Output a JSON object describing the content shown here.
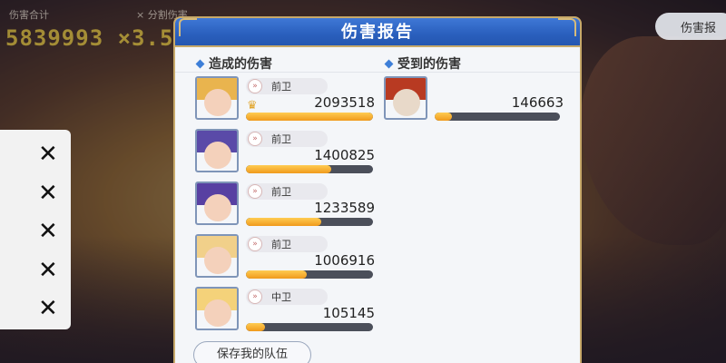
{
  "hud": {
    "total_label": "伤害合计",
    "dps_label": "× 分割伤害",
    "total_value": "5839993 ×3.5"
  },
  "top_right": {
    "label": "伤害报"
  },
  "side_panel": {
    "items": [
      "✕",
      "✕",
      "✕",
      "✕",
      "✕"
    ]
  },
  "dialog": {
    "title": "伤害报告",
    "dealt_title": "造成的伤害",
    "received_title": "受到的伤害",
    "save_label": "保存我的队伍"
  },
  "dealt": [
    {
      "role": "前卫",
      "value": "2093518",
      "crown": "♛",
      "ratio": 1.0,
      "hair": "#e9b44e"
    },
    {
      "role": "前卫",
      "value": "1400825",
      "crown": "",
      "ratio": 0.669,
      "hair": "#5a4aa8"
    },
    {
      "role": "前卫",
      "value": "1233589",
      "crown": "",
      "ratio": 0.589,
      "hair": "#5840a2"
    },
    {
      "role": "前卫",
      "value": "1006916",
      "crown": "",
      "ratio": 0.481,
      "hair": "#f1d08a"
    },
    {
      "role": "中卫",
      "value": "105145",
      "crown": "",
      "ratio": 0.15,
      "hair": "#f4d27a"
    }
  ],
  "received": [
    {
      "value": "146663",
      "ratio": 0.14,
      "hair": "#b83a22"
    }
  ],
  "colors": {
    "header_blue": "#2a5fbd",
    "bar_orange": "#f09a1c",
    "gold_border": "#c7a96a"
  }
}
